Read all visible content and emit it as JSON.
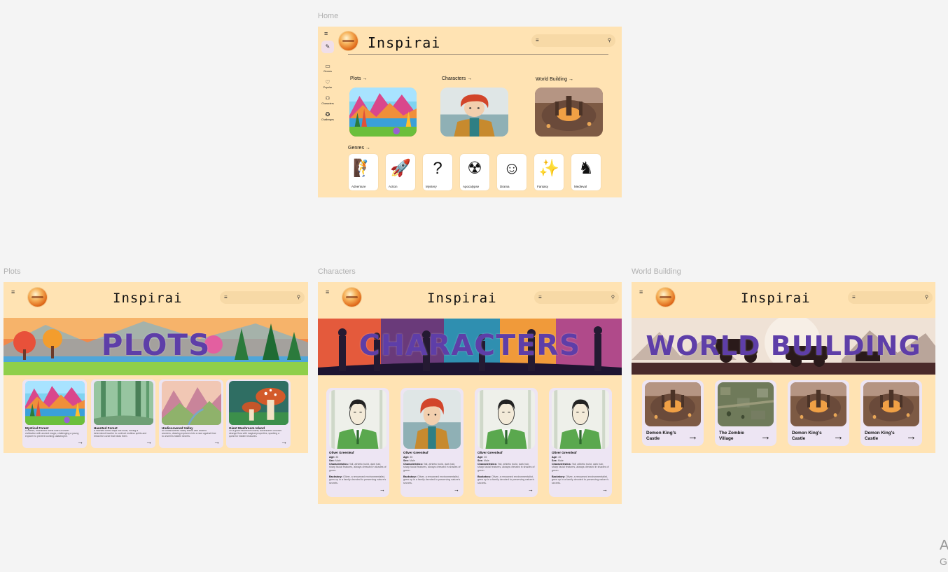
{
  "frame_labels": {
    "home": "Home",
    "plots": "Plots",
    "characters": "Characters",
    "world": "World Building"
  },
  "app": {
    "title": "Inspirai"
  },
  "icons": {
    "menu": "menu-icon",
    "search": "search-icon",
    "edit": "pencil-icon",
    "logo": "planet-logo",
    "arrow": "arrow-right-icon"
  },
  "home": {
    "rail": [
      {
        "label": "Genres",
        "icon": "folder-icon"
      },
      {
        "label": "Popular",
        "icon": "heart-icon"
      },
      {
        "label": "Characters",
        "icon": "people-icon"
      },
      {
        "label": "Challenges",
        "icon": "star-badge-icon"
      }
    ],
    "sections": {
      "plots": "Plots",
      "characters": "Characters",
      "world": "World Building",
      "genres": "Genres"
    },
    "genres": [
      {
        "label": "Adventure",
        "icon": "adventure-icon"
      },
      {
        "label": "Action",
        "icon": "rocket-icon"
      },
      {
        "label": "Mystery",
        "icon": "mystery-box-icon"
      },
      {
        "label": "Apocalypse",
        "icon": "explosion-icon"
      },
      {
        "label": "Drama",
        "icon": "masks-icon"
      },
      {
        "label": "Fantasy",
        "icon": "magic-wand-icon"
      },
      {
        "label": "Medieval",
        "icon": "knight-icon"
      }
    ]
  },
  "plots": {
    "banner_title": "PLOTS",
    "cards": [
      {
        "title": "Mystical Forest",
        "desc": "A vibrant, enchanted forest hides a secret civilization with ancient magic, challenging a young explorer to prevent looming catastrophe."
      },
      {
        "title": "Haunted Forest",
        "desc": "A haunted forest traps lost souls, forcing a determined traveler to confront restless spirits and break the curse that binds them."
      },
      {
        "title": "Undiscovered Valley",
        "desc": "An undiscovered valley teems with ancient wonders, drawing explorers into a race against time to unveil its hidden secrets."
      },
      {
        "title": "Giant Mushroom Island",
        "desc": "On a giant mushroom island, adventurers uncover strange flora with magical properties, sparking a quest for hidden treasures."
      }
    ]
  },
  "characters": {
    "banner_title": "CHARACTERS",
    "labels": {
      "age": "Age:",
      "sex": "Sex:",
      "characteristics": "Characteristics:",
      "backstory": "Backstory:"
    },
    "cards": [
      {
        "name": "Oliver Greenleaf",
        "age": "35",
        "sex": "Male",
        "characteristics": "Tall, athletic build, dark hair, sharp facial features, always dressed in shades of green.",
        "backstory": "Oliver, a renowned environmentalist, grew up in a family devoted to preserving nature's secrets."
      },
      {
        "name": "Oliver Greenleaf",
        "age": "35",
        "sex": "Male",
        "characteristics": "Tall, athletic build, dark hair, sharp facial features, always dressed in shades of green.",
        "backstory": "Oliver, a renowned environmentalist, grew up in a family devoted to preserving nature's secrets."
      },
      {
        "name": "Oliver Greenleaf",
        "age": "35",
        "sex": "Male",
        "characteristics": "Tall, athletic build, dark hair, sharp facial features, always dressed in shades of green.",
        "backstory": "Oliver, a renowned environmentalist, grew up in a family devoted to preserving nature's secrets."
      },
      {
        "name": "Oliver Greenleaf",
        "age": "35",
        "sex": "Male",
        "characteristics": "Tall, athletic build, dark hair, sharp facial features, always dressed in shades of green.",
        "backstory": "Oliver, a renowned environmentalist, grew up in a family devoted to preserving nature's secrets."
      }
    ]
  },
  "world": {
    "banner_title": "WORLD BUILDING",
    "cards": [
      {
        "title": "Demon King's Castle"
      },
      {
        "title": "The Zombie Village"
      },
      {
        "title": "Demon King's Castle"
      },
      {
        "title": "Demon King's Castle"
      }
    ]
  },
  "corner": {
    "line1": "A",
    "line2": "G"
  },
  "colors": {
    "canvas": "#f4f4f4",
    "frame_bg": "#ffe3b3",
    "card_bg": "#ede5f3",
    "banner_title": "#5e3ea8",
    "search_bg": "#f7d9a6"
  }
}
